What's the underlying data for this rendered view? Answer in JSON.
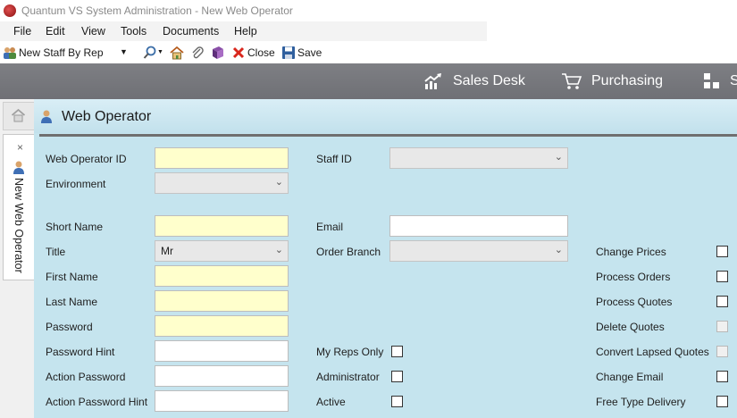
{
  "window": {
    "title": "Quantum VS System Administration  -  New Web Operator"
  },
  "menu": [
    "File",
    "Edit",
    "View",
    "Tools",
    "Documents",
    "Help"
  ],
  "toolbar": {
    "new_staff_label": "New Staff By Rep",
    "close_label": "Close",
    "save_label": "Save"
  },
  "modules": [
    "Sales Desk",
    "Purchasing",
    "S"
  ],
  "side_tab": {
    "close": "×",
    "label": "New Web Operator"
  },
  "panel": {
    "title": "Web Operator"
  },
  "form": {
    "web_operator_id": {
      "label": "Web Operator ID",
      "value": ""
    },
    "staff_id": {
      "label": "Staff ID",
      "value": ""
    },
    "environment": {
      "label": "Environment",
      "value": ""
    },
    "short_name": {
      "label": "Short Name",
      "value": ""
    },
    "email": {
      "label": "Email",
      "value": ""
    },
    "title": {
      "label": "Title",
      "value": "Mr"
    },
    "order_branch": {
      "label": "Order Branch",
      "value": ""
    },
    "first_name": {
      "label": "First Name",
      "value": ""
    },
    "last_name": {
      "label": "Last Name",
      "value": ""
    },
    "password": {
      "label": "Password",
      "value": ""
    },
    "password_hint": {
      "label": "Password Hint",
      "value": ""
    },
    "action_password": {
      "label": "Action Password",
      "value": ""
    },
    "action_password_hint": {
      "label": "Action Password Hint",
      "value": ""
    },
    "my_reps_only": {
      "label": "My Reps Only",
      "checked": false
    },
    "administrator": {
      "label": "Administrator",
      "checked": false
    },
    "active": {
      "label": "Active",
      "checked": false
    }
  },
  "permissions": [
    {
      "label": "Change Prices",
      "checked": false,
      "enabled": true
    },
    {
      "label": "Process Orders",
      "checked": false,
      "enabled": true
    },
    {
      "label": "Process Quotes",
      "checked": false,
      "enabled": true
    },
    {
      "label": "Delete Quotes",
      "checked": false,
      "enabled": false
    },
    {
      "label": "Convert Lapsed Quotes",
      "checked": false,
      "enabled": false
    },
    {
      "label": "Change Email",
      "checked": false,
      "enabled": true
    },
    {
      "label": "Free Type Delivery",
      "checked": false,
      "enabled": true
    }
  ],
  "icons": {
    "app": "app-logo-icon",
    "new_staff": "users-icon",
    "dropdown": "chevron-down-icon",
    "search": "search-icon",
    "home": "home-icon",
    "attach": "paperclip-icon",
    "book": "book-icon",
    "close": "close-icon",
    "save": "save-icon",
    "sales": "chart-trend-icon",
    "purchasing": "cart-icon",
    "module3": "grid-icon",
    "operator": "user-icon"
  },
  "colors": {
    "panel_bg": "#c5e4ee",
    "required_field": "#ffffcc",
    "module_bar": "#77787d",
    "close_red": "#d9261c"
  }
}
